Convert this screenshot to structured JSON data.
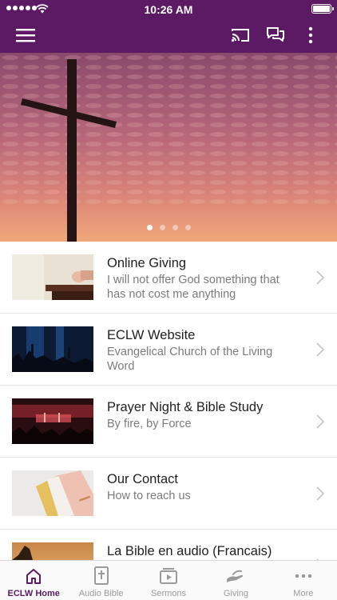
{
  "status_bar": {
    "time": "10:26 AM"
  },
  "app_bar": {
    "menu_icon": "hamburger-menu-icon",
    "cast_icon": "cast-icon",
    "chat_icon": "chat-bubbles-icon",
    "more_icon": "vertical-dots-icon"
  },
  "carousel": {
    "slide_count": 4,
    "active_index": 0
  },
  "items": [
    {
      "title": "Online Giving",
      "subtitle": "I will not offer God something that has not cost me anything"
    },
    {
      "title": "ECLW Website",
      "subtitle": "Evangelical Church of the Living Word"
    },
    {
      "title": "Prayer Night & Bible Study",
      "subtitle": "By fire, by Force"
    },
    {
      "title": "Our Contact",
      "subtitle": "How to reach us"
    },
    {
      "title": "La Bible en audio (Francais)",
      "subtitle": ""
    }
  ],
  "tabs": [
    {
      "label": "ECLW Home",
      "icon": "home-icon",
      "active": true
    },
    {
      "label": "Audio Bible",
      "icon": "bible-icon",
      "active": false
    },
    {
      "label": "Sermons",
      "icon": "video-player-icon",
      "active": false
    },
    {
      "label": "Giving",
      "icon": "giving-hand-icon",
      "active": false
    },
    {
      "label": "More",
      "icon": "more-dots-icon",
      "active": false
    }
  ],
  "colors": {
    "brand": "#5b1a63",
    "active_tab": "#5b1a63",
    "inactive_tab": "#9a9a9a"
  }
}
